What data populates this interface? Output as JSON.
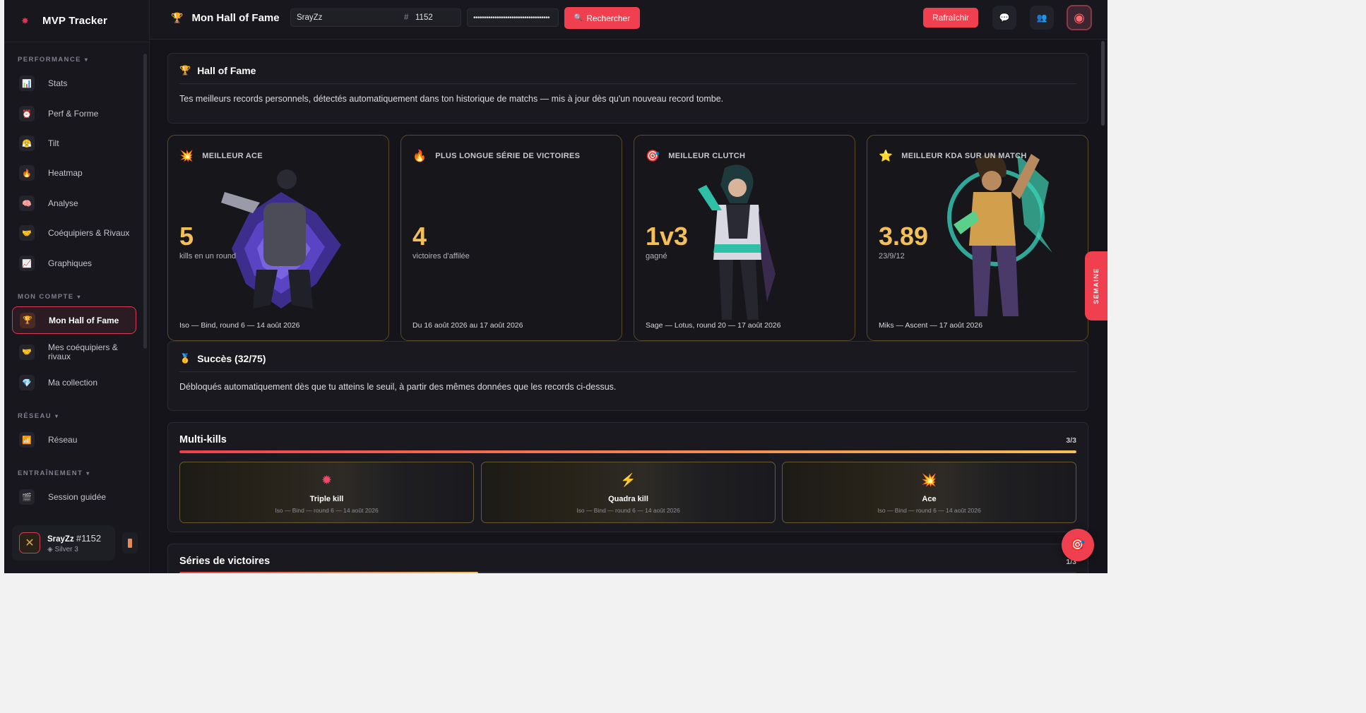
{
  "app": {
    "name": "MVP Tracker"
  },
  "sidebar": {
    "sections": [
      {
        "title": "PERFORMANCE",
        "items": [
          {
            "label": "Stats",
            "icon": "stats-icon"
          },
          {
            "label": "Perf & Forme",
            "icon": "alarm-clock-icon"
          },
          {
            "label": "Tilt",
            "icon": "angry-face-icon"
          },
          {
            "label": "Heatmap",
            "icon": "fire-icon"
          },
          {
            "label": "Analyse",
            "icon": "brain-icon"
          },
          {
            "label": "Coéquipiers & Rivaux",
            "icon": "handshake-icon"
          },
          {
            "label": "Graphiques",
            "icon": "line-chart-icon"
          }
        ]
      },
      {
        "title": "MON COMPTE",
        "items": [
          {
            "label": "Mon Hall of Fame",
            "icon": "trophy-icon",
            "active": true
          },
          {
            "label": "Mes coéquipiers & rivaux",
            "icon": "handshake-icon"
          },
          {
            "label": "Ma collection",
            "icon": "gem-icon"
          }
        ]
      },
      {
        "title": "RÉSEAU",
        "items": [
          {
            "label": "Réseau",
            "icon": "bar-chart-icon"
          }
        ]
      },
      {
        "title": "ENTRAÎNEMENT",
        "items": [
          {
            "label": "Session guidée",
            "icon": "clapper-icon"
          }
        ]
      }
    ],
    "user": {
      "name": "SrayZz",
      "tag": "#1152",
      "rank": "Silver 3"
    }
  },
  "header": {
    "title": "Mon Hall of Fame",
    "riot_name": "SrayZz",
    "riot_hash": "#",
    "riot_tag": "1152",
    "api_key_masked": "••••••••••••••••••••••••••••••••••••",
    "search_label": "Rechercher",
    "refresh_label": "Rafraîchir"
  },
  "hall": {
    "title": "Hall of Fame",
    "description": "Tes meilleurs records personnels, détectés automatiquement dans ton historique de matchs — mis à jour dès qu'un nouveau record tombe."
  },
  "records": [
    {
      "label": "MEILLEUR ACE",
      "icon": "explosion-icon",
      "value": "5",
      "sub": "kills en un round",
      "foot": "Iso — Bind, round 6 — 14 août 2026"
    },
    {
      "label": "PLUS LONGUE SÉRIE DE VICTOIRES",
      "icon": "fire-icon",
      "value": "4",
      "sub": "victoires d'affilée",
      "foot": "Du 16 août 2026 au 17 août 2026"
    },
    {
      "label": "MEILLEUR CLUTCH",
      "icon": "target-icon",
      "value": "1v3",
      "sub": "gagné",
      "foot": "Sage — Lotus, round 20 — 17 août 2026"
    },
    {
      "label": "MEILLEUR KDA SUR UN MATCH",
      "icon": "star-icon",
      "value": "3.89",
      "sub": "23/9/12",
      "foot": "Miks — Ascent — 17 août 2026"
    }
  ],
  "achievements": {
    "title": "Succès (32/75)",
    "description": "Débloqués automatiquement dès que tu atteins le seuil, à partir des mêmes données que les records ci-dessus."
  },
  "multikills": {
    "title": "Multi-kills",
    "count": "3/3",
    "progress": 1.0,
    "items": [
      {
        "title": "Triple kill",
        "meta": "Iso — Bind — round 6 — 14 août 2026",
        "icon": "burst-icon"
      },
      {
        "title": "Quadra kill",
        "meta": "Iso — Bind — round 6 — 14 août 2026",
        "icon": "lightning-icon"
      },
      {
        "title": "Ace",
        "meta": "Iso — Bind — round 6 — 14 août 2026",
        "icon": "explosion-icon"
      }
    ]
  },
  "streaks": {
    "title": "Séries de victoires",
    "count": "1/3",
    "progress": 0.333
  },
  "week_tab": "SEMAINE",
  "colors": {
    "accent": "#f0404f",
    "gold": "#f3bf58",
    "background": "#14141a",
    "panel": "#19191f"
  }
}
